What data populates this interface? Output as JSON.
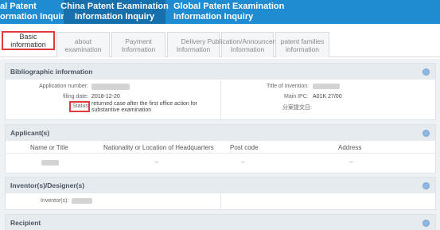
{
  "nav": {
    "item0_line1": "al Patent",
    "item0_line2": "ormation Inquiry",
    "item1_line1": "China Patent Examination",
    "item1_line2": "Information Inquiry",
    "item2_line1": "Global Patent Examination",
    "item2_line2": "Information Inquiry"
  },
  "tabs": [
    {
      "label": "Basic information"
    },
    {
      "label": "about examination"
    },
    {
      "label": "Payment Information"
    },
    {
      "label": "Delivery Information"
    },
    {
      "label": "Publication/Announcement Information"
    },
    {
      "label": "patent families information"
    }
  ],
  "biblio": {
    "title": "Bibliographic information",
    "app_number_label": "Application number:",
    "filing_date_label": "filing date:",
    "filing_date_value": "2018-12-20",
    "status_label": "Status:",
    "status_value": "returned case after the first office action for substantive examination",
    "title_invention_label": "Title of Invention:",
    "main_ipc_label": "Main IPC:",
    "main_ipc_value": "A01K 27/00",
    "division_date_label": "分案提交日:"
  },
  "applicant": {
    "title": "Applicant(s)",
    "columns": [
      "Name or Title",
      "Nationality or Location of Headquarters",
      "Post code",
      "Address"
    ],
    "row": [
      "",
      "--",
      "--",
      "--"
    ]
  },
  "inventor": {
    "title": "Inventor(s)/Designer(s)",
    "label": "Inventor(s):"
  },
  "recipient": {
    "title": "Recipient"
  }
}
